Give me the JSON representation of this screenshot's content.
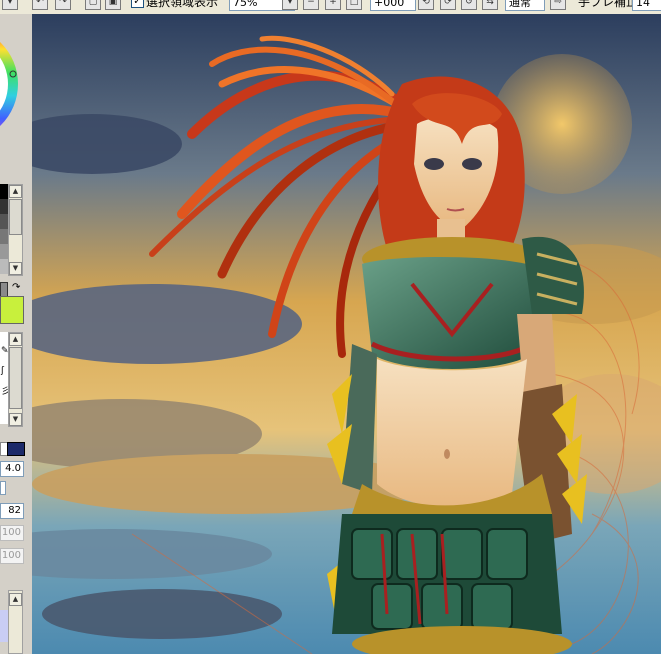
{
  "toolbar": {
    "selection_checkbox_checked": true,
    "selection_label": "選択領域表示",
    "zoom_value": "75%",
    "rotation_value": "+000",
    "mode_value": "通常",
    "stabilizer_label": "手ブレ補正",
    "stabilizer_value": "14"
  },
  "left_panel": {
    "brush_size": "4.0",
    "density": "82",
    "value_1": "100",
    "value_2": "100"
  },
  "colors": {
    "primary_color": "#c8f03c",
    "secondary_color": "#8a8a8a",
    "accent": "#1c5180"
  }
}
